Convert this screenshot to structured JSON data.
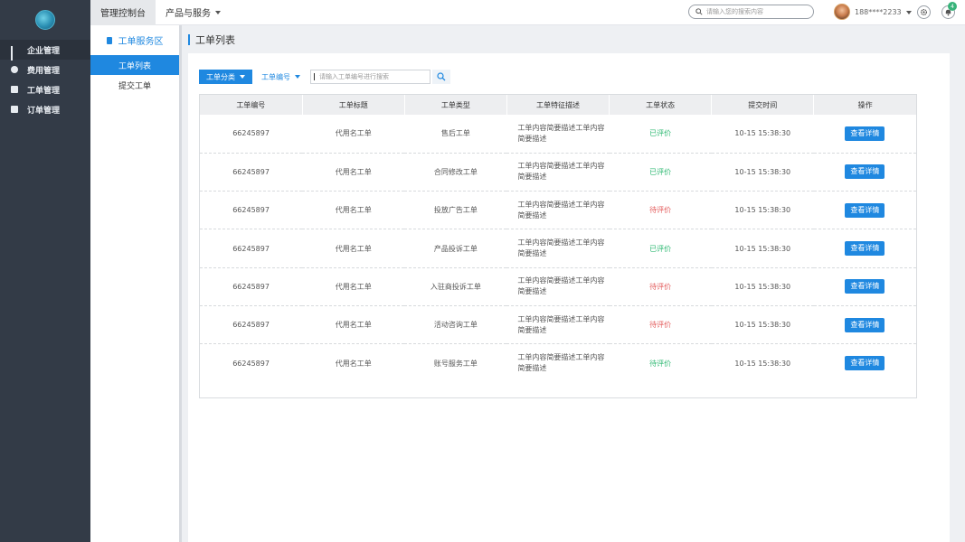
{
  "topbar": {
    "tabs": [
      {
        "label": "管理控制台"
      },
      {
        "label": "产品与服务"
      }
    ],
    "search_placeholder": "请输入您的搜索内容",
    "user_name": "188****2233",
    "notification_count": "4"
  },
  "sidebar": {
    "items": [
      {
        "label": "企业管理",
        "icon": "chart-bars-icon"
      },
      {
        "label": "费用管理",
        "icon": "yen-icon"
      },
      {
        "label": "工单管理",
        "icon": "clipboard-icon"
      },
      {
        "label": "订单管理",
        "icon": "document-icon"
      }
    ]
  },
  "subnav": {
    "title": "工单服务区",
    "items": [
      {
        "label": "工单列表"
      },
      {
        "label": "提交工单"
      }
    ]
  },
  "main": {
    "page_title": "工单列表",
    "filters": {
      "category_label": "工单分类",
      "number_label": "工单编号",
      "search_placeholder": "请输入工单编号进行搜索"
    },
    "table": {
      "headers": [
        "工单编号",
        "工单标题",
        "工单类型",
        "工单特征描述",
        "工单状态",
        "提交时间",
        "操作"
      ],
      "rows": [
        {
          "id": "66245897",
          "title": "代用名工单",
          "type": "售后工单",
          "desc": "工单内容简要描述工单内容简要描述",
          "status": "已评价",
          "time": "10-15 15:38:30",
          "action": "查看详情"
        },
        {
          "id": "66245897",
          "title": "代用名工单",
          "type": "合同修改工单",
          "desc": "工单内容简要描述工单内容简要描述",
          "status": "已评价",
          "time": "10-15 15:38:30",
          "action": "查看详情"
        },
        {
          "id": "66245897",
          "title": "代用名工单",
          "type": "投放广告工单",
          "desc": "工单内容简要描述工单内容简要描述",
          "status": "待评价",
          "time": "10-15 15:38:30",
          "action": "查看详情"
        },
        {
          "id": "66245897",
          "title": "代用名工单",
          "type": "产品投诉工单",
          "desc": "工单内容简要描述工单内容简要描述",
          "status": "已评价",
          "time": "10-15 15:38:30",
          "action": "查看详情"
        },
        {
          "id": "66245897",
          "title": "代用名工单",
          "type": "入驻商投诉工单",
          "desc": "工单内容简要描述工单内容简要描述",
          "status": "待评价",
          "time": "10-15 15:38:30",
          "action": "查看详情"
        },
        {
          "id": "66245897",
          "title": "代用名工单",
          "type": "活动咨询工单",
          "desc": "工单内容简要描述工单内容简要描述",
          "status": "待评价",
          "time": "10-15 15:38:30",
          "action": "查看详情"
        },
        {
          "id": "66245897",
          "title": "代用名工单",
          "type": "账号服务工单",
          "desc": "工单内容简要描述工单内容简要描述",
          "status": "待评价",
          "time": "10-15 15:38:30",
          "action": "查看详情"
        }
      ]
    }
  },
  "colors": {
    "accent": "#1f88e0",
    "sidebar_bg": "#333b47",
    "status_done": "#2eb872",
    "status_wait_red": "#e35b5b",
    "status_wait_green": "#2eb872"
  }
}
